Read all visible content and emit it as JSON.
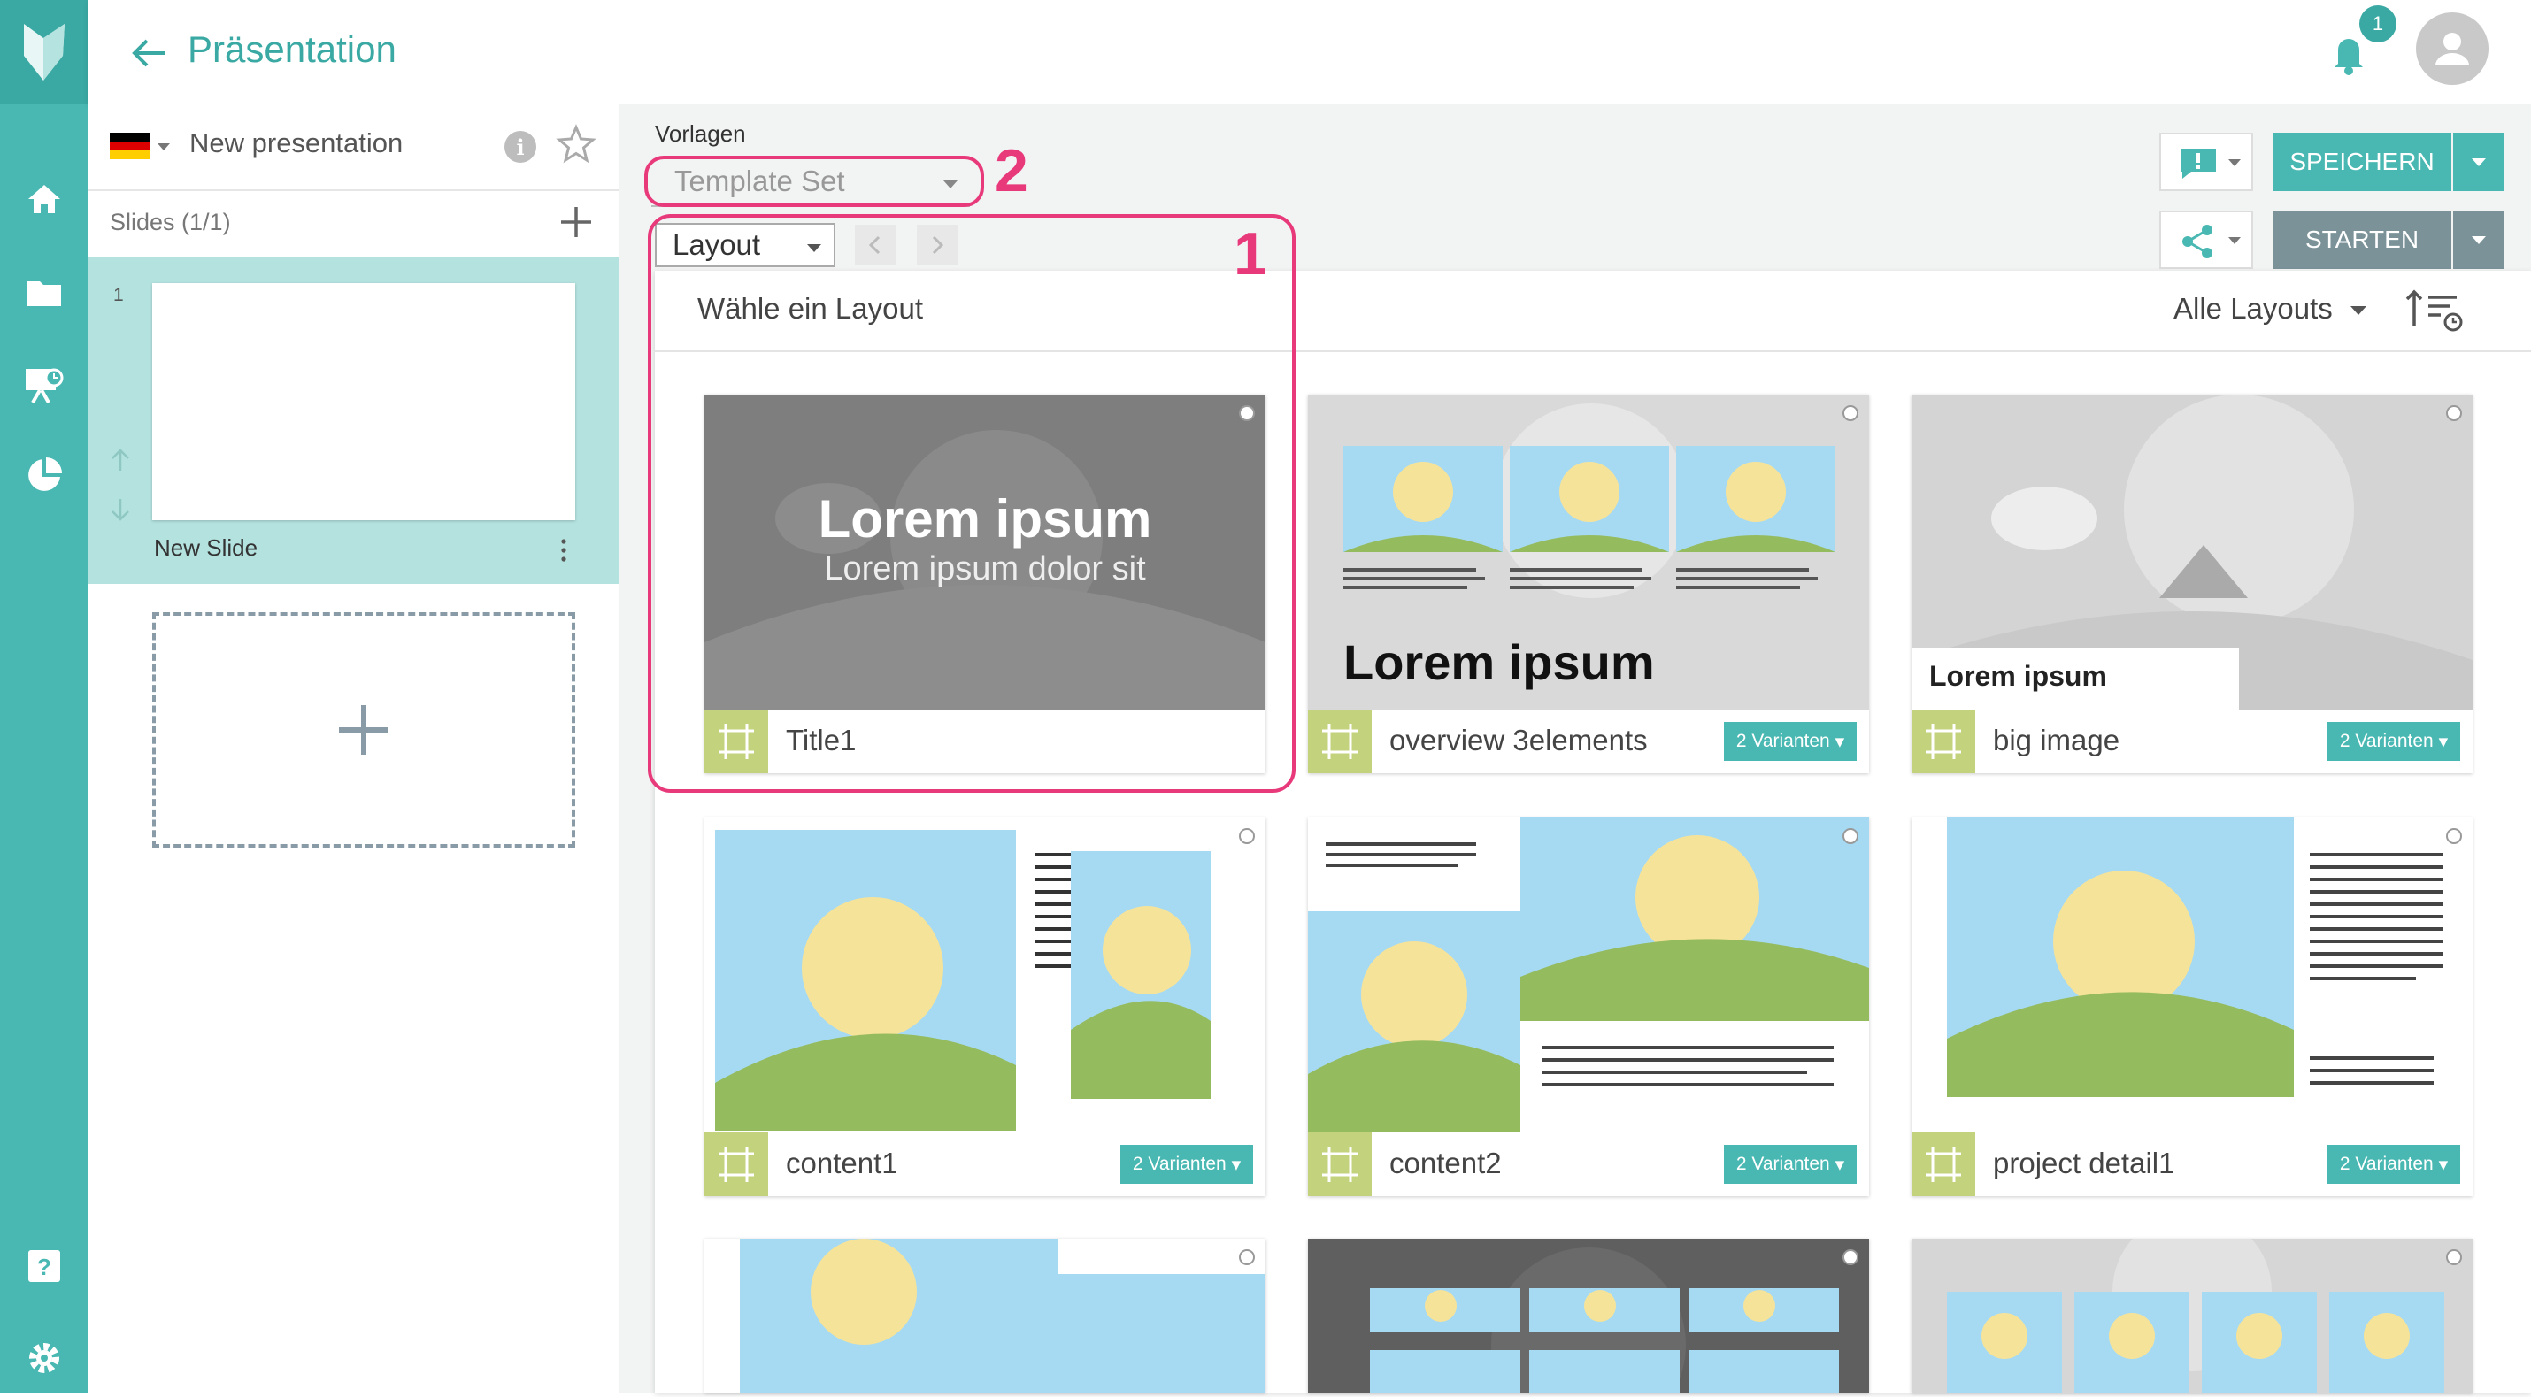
{
  "header": {
    "title": "Präsentation",
    "notification_count": "1"
  },
  "sidebar_rail": {
    "icons": [
      "logo-icon",
      "home-icon",
      "folder-icon",
      "presentation-icon",
      "chart-pie-icon",
      "help-icon",
      "settings-icon"
    ]
  },
  "presentation": {
    "name": "New presentation",
    "info": "i"
  },
  "slides": {
    "count_label": "Slides (1/1)",
    "items": [
      {
        "number": "1",
        "name": "New Slide"
      }
    ]
  },
  "vorlagen": {
    "label": "Vorlagen",
    "template_set": "Template Set",
    "layout": "Layout"
  },
  "actions": {
    "save": "SPEICHERN",
    "start": "STARTEN"
  },
  "chooser": {
    "title": "Wähle ein Layout",
    "filter": "Alle Layouts",
    "layouts": [
      {
        "name": "Title1",
        "variants": "",
        "thumb_title": "Lorem ipsum",
        "thumb_sub": "Lorem ipsum dolor sit"
      },
      {
        "name": "overview 3elements",
        "variants": "2 Varianten",
        "thumb_title": "Lorem ipsum"
      },
      {
        "name": "big image",
        "variants": "2 Varianten",
        "thumb_title": "Lorem ipsum"
      },
      {
        "name": "content1",
        "variants": "2 Varianten"
      },
      {
        "name": "content2",
        "variants": "2 Varianten"
      },
      {
        "name": "project detail1",
        "variants": "2 Varianten"
      }
    ]
  },
  "annotations": {
    "one": "1",
    "two": "2"
  },
  "colors": {
    "teal": "#49b8b2",
    "teal_dark": "#3aa9a3",
    "start_gray": "#7a9298",
    "annotation": "#e8397a",
    "layout_icon": "#c3d27c"
  }
}
